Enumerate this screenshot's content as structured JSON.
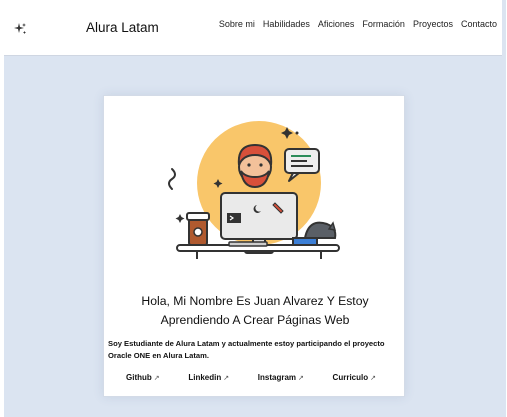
{
  "header": {
    "brand": "Alura Latam",
    "theme_icon": "sparkle-icon",
    "nav": [
      "Sobre mi",
      "Habilidades",
      "Aficiones",
      "Formación",
      "Proyectos",
      "Contacto"
    ]
  },
  "card": {
    "title_line1": "Hola, Mi Nombre Es Juan Alvarez Y Estoy",
    "title_line2": "Aprendiendo A Crear Páginas Web",
    "description_line1": "Soy Estudiante de Alura Latam y actualmente estoy participando el proyecto",
    "description_line2": "Oracle ONE en Alura Latam.",
    "links": [
      {
        "label": "Github",
        "icon": "external-link-icon"
      },
      {
        "label": "Linkedin",
        "icon": "external-link-icon"
      },
      {
        "label": "Instagram",
        "icon": "external-link-icon"
      },
      {
        "label": "Curriculo",
        "icon": "external-link-icon"
      }
    ],
    "link_arrow": "↗"
  },
  "colors": {
    "page_background": "#dbe4f1",
    "sun": "#f9c66a",
    "hair": "#d8503a"
  }
}
